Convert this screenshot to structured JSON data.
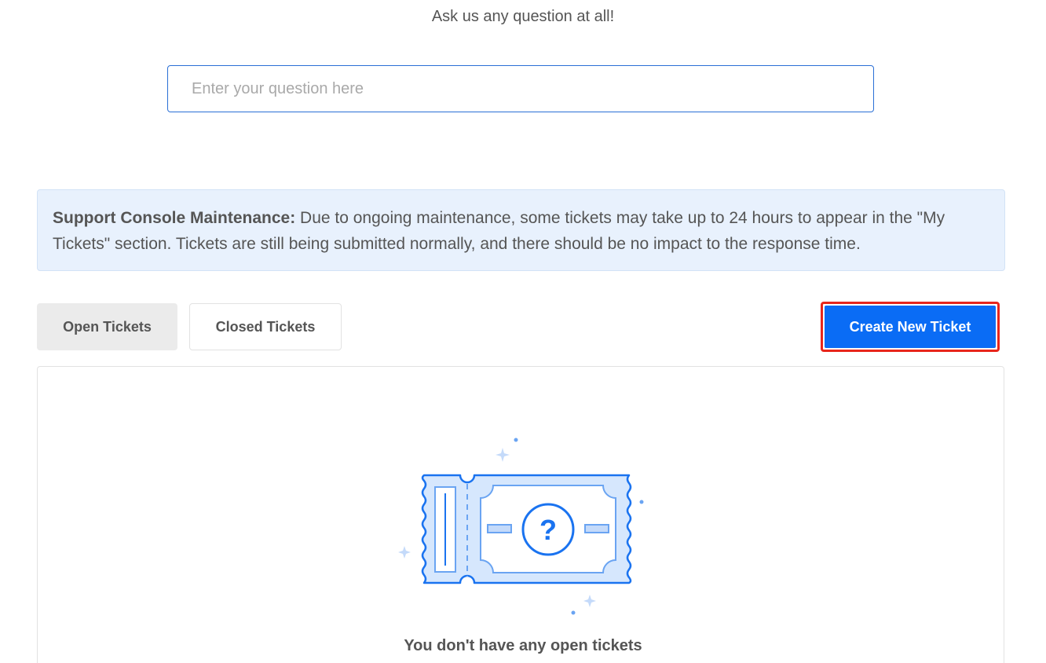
{
  "header": {
    "subtitle": "Ask us any question at all!"
  },
  "search": {
    "placeholder": "Enter your question here",
    "value": ""
  },
  "notice": {
    "title": "Support Console Maintenance:",
    "body": " Due to ongoing maintenance, some tickets may take up to 24 hours to appear in the \"My Tickets\" section. Tickets are still being submitted normally, and there should be no impact to the response time."
  },
  "tabs": [
    {
      "label": "Open Tickets",
      "active": true
    },
    {
      "label": "Closed Tickets",
      "active": false
    }
  ],
  "actions": {
    "create_label": "Create New Ticket"
  },
  "empty_state": {
    "icon": "ticket-question-icon",
    "message": "You don't have any open tickets"
  },
  "colors": {
    "accent": "#0a6cf5",
    "highlight_border": "#e8261c",
    "notice_bg": "#e8f1fd",
    "illustration_fill": "#d6e7fd"
  }
}
